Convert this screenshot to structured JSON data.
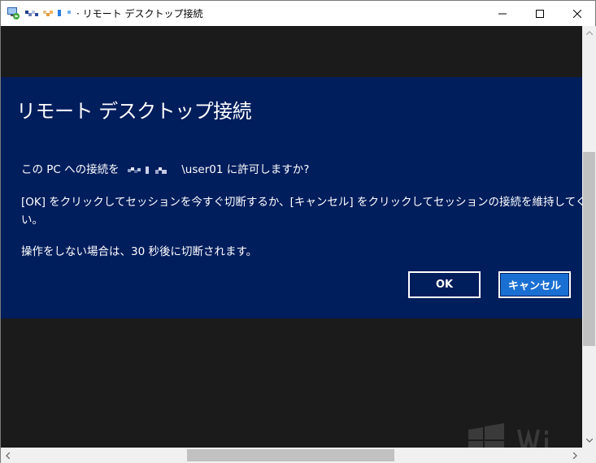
{
  "window": {
    "title": "リモート デスクトップ接続",
    "title_prefix_mark": "·"
  },
  "titlebar": {
    "minimize_label": "—",
    "maximize_label": "☐",
    "close_label": "✕"
  },
  "dialog": {
    "title": "リモート デスクトップ接続",
    "line1_before": "この PC への接続を",
    "line1_user": "\\user01",
    "line1_after": " に許可しますか?",
    "line2": "[OK] をクリックしてセッションを今すぐ切断するか、[キャンセル] をクリックしてセッションの接続を維持してくださ",
    "line3": "い。",
    "line4": "操作をしない場合は、30 秒後に切断されます。",
    "ok_label": "OK",
    "cancel_label": "キャンセル"
  },
  "colors": {
    "dialog_bg": "#001d5c",
    "remote_bg": "#1b1b1b",
    "cancel_button_bg": "#1a6fd2",
    "scrollbar_bg": "#f0f0f0",
    "scroll_thumb": "#c1c1c1"
  },
  "icons": [
    "remote-desktop-app-icon",
    "minimize-icon",
    "maximize-icon",
    "close-icon",
    "scroll-up-arrow-icon",
    "scroll-down-arrow-icon",
    "scroll-left-arrow-icon",
    "scroll-right-arrow-icon",
    "windows-logo-icon"
  ]
}
